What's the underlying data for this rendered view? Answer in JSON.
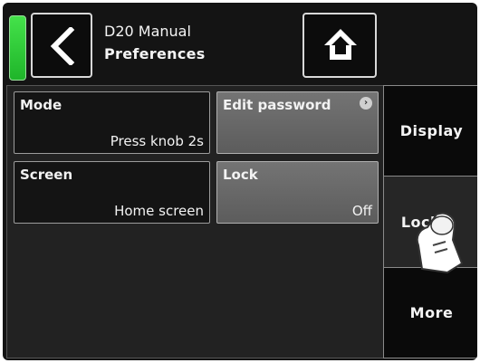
{
  "header": {
    "device_name": "D20 Manual",
    "page_title": "Preferences",
    "status_color": "#2fd43a"
  },
  "tiles": {
    "mode": {
      "label": "Mode",
      "value": "Press knob 2s"
    },
    "edit_password": {
      "label": "Edit password",
      "icon": "info-icon"
    },
    "screen": {
      "label": "Screen",
      "value": "Home screen"
    },
    "lock": {
      "label": "Lock",
      "value": "Off"
    }
  },
  "tabs": {
    "display": "Display",
    "lock": "Lock",
    "more": "More",
    "selected": "lock"
  }
}
